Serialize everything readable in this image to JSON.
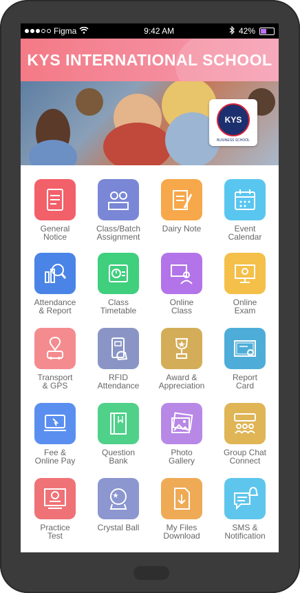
{
  "status": {
    "carrier": "Figma",
    "time": "9:42 AM",
    "battery": "42%"
  },
  "header": {
    "title": "KYS INTERNATIONAL SCHOOL"
  },
  "banner": {
    "logo_text": "KYS",
    "logo_caption": "BUSINESS SCHOOL"
  },
  "tiles": [
    {
      "label": "General\nNotice",
      "color": "#f2606a",
      "icon": "notice-icon"
    },
    {
      "label": "Class/Batch\nAssignment",
      "color": "#7a87d6",
      "icon": "assignment-icon"
    },
    {
      "label": "Dairy Note",
      "color": "#f6a84a",
      "icon": "note-icon"
    },
    {
      "label": "Event\nCalendar",
      "color": "#59c6ef",
      "icon": "calendar-icon"
    },
    {
      "label": "Attendance\n& Report",
      "color": "#4a84e6",
      "icon": "attendance-icon"
    },
    {
      "label": "Class\nTimetable",
      "color": "#3fcf7d",
      "icon": "timetable-icon"
    },
    {
      "label": "Online\nClass",
      "color": "#b274e8",
      "icon": "online-class-icon"
    },
    {
      "label": "Online\nExam",
      "color": "#f4c04a",
      "icon": "exam-icon"
    },
    {
      "label": "Transport\n& GPS",
      "color": "#f48b8f",
      "icon": "transport-icon"
    },
    {
      "label": "RFID\nAttendance",
      "color": "#8a95c6",
      "icon": "rfid-icon"
    },
    {
      "label": "Award &\nAppreciation",
      "color": "#d4ad58",
      "icon": "award-icon"
    },
    {
      "label": "Report\nCard",
      "color": "#4eadd8",
      "icon": "report-card-icon"
    },
    {
      "label": "Fee &\nOnline Pay",
      "color": "#5a8ff0",
      "icon": "fee-icon"
    },
    {
      "label": "Question\nBank",
      "color": "#4fd18a",
      "icon": "question-bank-icon"
    },
    {
      "label": "Photo\nGallery",
      "color": "#b888e6",
      "icon": "gallery-icon"
    },
    {
      "label": "Group Chat\nConnect",
      "color": "#dfb556",
      "icon": "group-chat-icon"
    },
    {
      "label": "Practice\nTest",
      "color": "#ef7276",
      "icon": "practice-test-icon"
    },
    {
      "label": "Crystal Ball",
      "color": "#8c96cf",
      "icon": "crystal-ball-icon"
    },
    {
      "label": "My Files\nDownload",
      "color": "#efaa56",
      "icon": "download-icon"
    },
    {
      "label": "SMS &\nNotification",
      "color": "#5ec6ec",
      "icon": "sms-icon"
    }
  ]
}
